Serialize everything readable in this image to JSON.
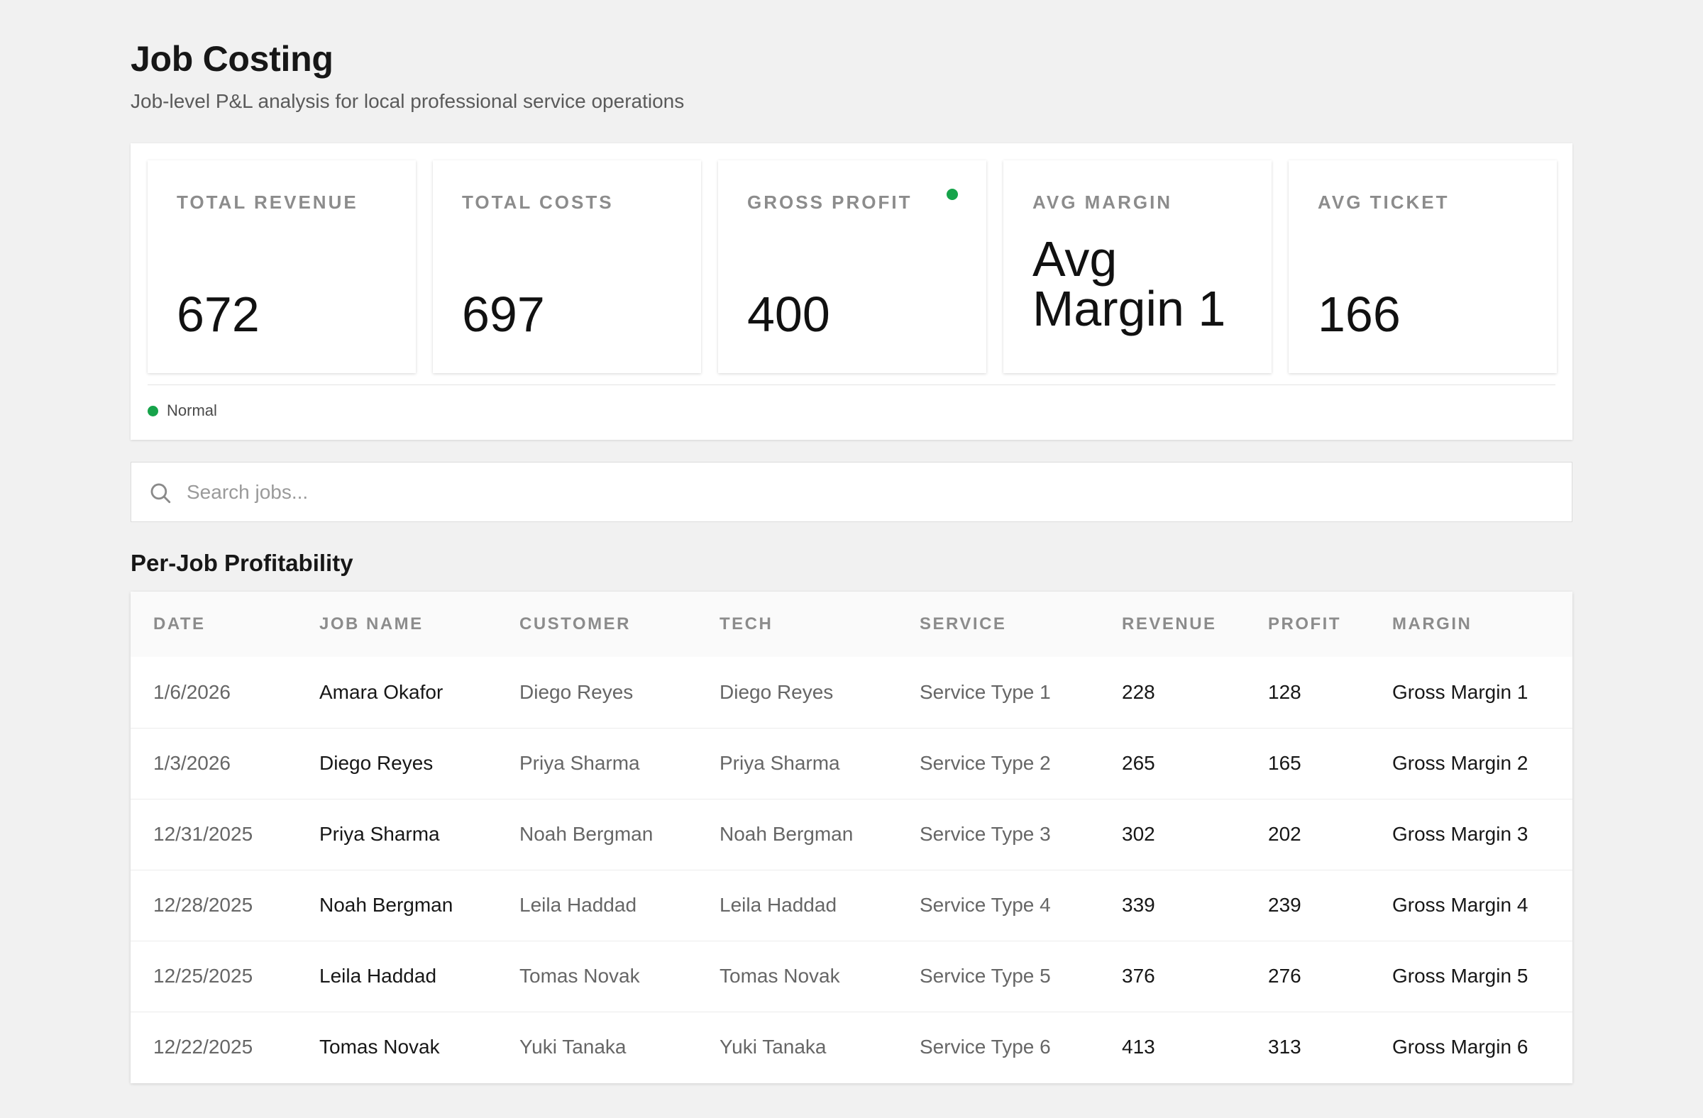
{
  "header": {
    "title": "Job Costing",
    "subtitle": "Job-level P&L analysis for local professional service operations"
  },
  "kpis": [
    {
      "label": "TOTAL REVENUE",
      "value": "672"
    },
    {
      "label": "TOTAL COSTS",
      "value": "697"
    },
    {
      "label": "GROSS PROFIT",
      "value": "400",
      "status_color": "#16a34a"
    },
    {
      "label": "AVG MARGIN",
      "value": "Avg Margin 1"
    },
    {
      "label": "AVG TICKET",
      "value": "166"
    }
  ],
  "legend": {
    "label": "Normal",
    "color": "#16a34a"
  },
  "search": {
    "placeholder": "Search jobs...",
    "value": "",
    "icon": "search-icon"
  },
  "table": {
    "title": "Per-Job Profitability",
    "columns": [
      "DATE",
      "JOB NAME",
      "CUSTOMER",
      "TECH",
      "SERVICE",
      "REVENUE",
      "PROFIT",
      "MARGIN"
    ],
    "rows": [
      {
        "date": "1/6/2026",
        "job": "Amara Okafor",
        "customer": "Diego Reyes",
        "tech": "Diego Reyes",
        "service": "Service Type 1",
        "revenue": "228",
        "profit": "128",
        "margin": "Gross Margin 1"
      },
      {
        "date": "1/3/2026",
        "job": "Diego Reyes",
        "customer": "Priya Sharma",
        "tech": "Priya Sharma",
        "service": "Service Type 2",
        "revenue": "265",
        "profit": "165",
        "margin": "Gross Margin 2"
      },
      {
        "date": "12/31/2025",
        "job": "Priya Sharma",
        "customer": "Noah Bergman",
        "tech": "Noah Bergman",
        "service": "Service Type 3",
        "revenue": "302",
        "profit": "202",
        "margin": "Gross Margin 3"
      },
      {
        "date": "12/28/2025",
        "job": "Noah Bergman",
        "customer": "Leila Haddad",
        "tech": "Leila Haddad",
        "service": "Service Type 4",
        "revenue": "339",
        "profit": "239",
        "margin": "Gross Margin 4"
      },
      {
        "date": "12/25/2025",
        "job": "Leila Haddad",
        "customer": "Tomas Novak",
        "tech": "Tomas Novak",
        "service": "Service Type 5",
        "revenue": "376",
        "profit": "276",
        "margin": "Gross Margin 5"
      },
      {
        "date": "12/22/2025",
        "job": "Tomas Novak",
        "customer": "Yuki Tanaka",
        "tech": "Yuki Tanaka",
        "service": "Service Type 6",
        "revenue": "413",
        "profit": "313",
        "margin": "Gross Margin 6"
      }
    ]
  }
}
